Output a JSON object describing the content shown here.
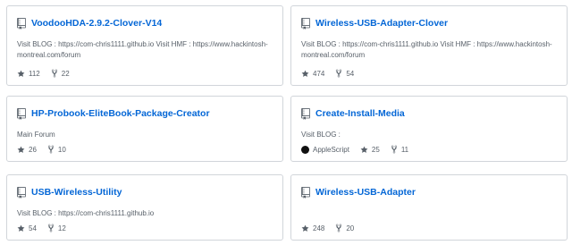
{
  "repos": [
    {
      "name": "VoodooHDA-2.9.2-Clover-V14",
      "description": "Visit BLOG : https://com-chris1111.github.io Visit HMF : https://www.hackintosh-montreal.com/forum",
      "stars": "112",
      "forks": "22"
    },
    {
      "name": "Wireless-USB-Adapter-Clover",
      "description": "Visit BLOG : https://com-chris1111.github.io Visit HMF : https://www.hackintosh-montreal.com/forum",
      "stars": "474",
      "forks": "54"
    },
    {
      "name": "HP-Probook-EliteBook-Package-Creator",
      "description": "Main Forum",
      "stars": "26",
      "forks": "10"
    },
    {
      "name": "Create-Install-Media",
      "description": "Visit BLOG :",
      "language": "AppleScript",
      "language_color": "#101010",
      "stars": "25",
      "forks": "11"
    },
    {
      "name": "USB-Wireless-Utility",
      "description": "Visit BLOG : https://com-chris1111.github.io",
      "stars": "54",
      "forks": "12"
    },
    {
      "name": "Wireless-USB-Adapter",
      "description": "",
      "stars": "248",
      "forks": "20"
    }
  ],
  "icons": {
    "repo": "repo-icon",
    "star": "star-icon",
    "fork": "fork-icon"
  },
  "colors": {
    "link": "#0366d6",
    "muted": "#586069",
    "border": "#d1d5da"
  }
}
